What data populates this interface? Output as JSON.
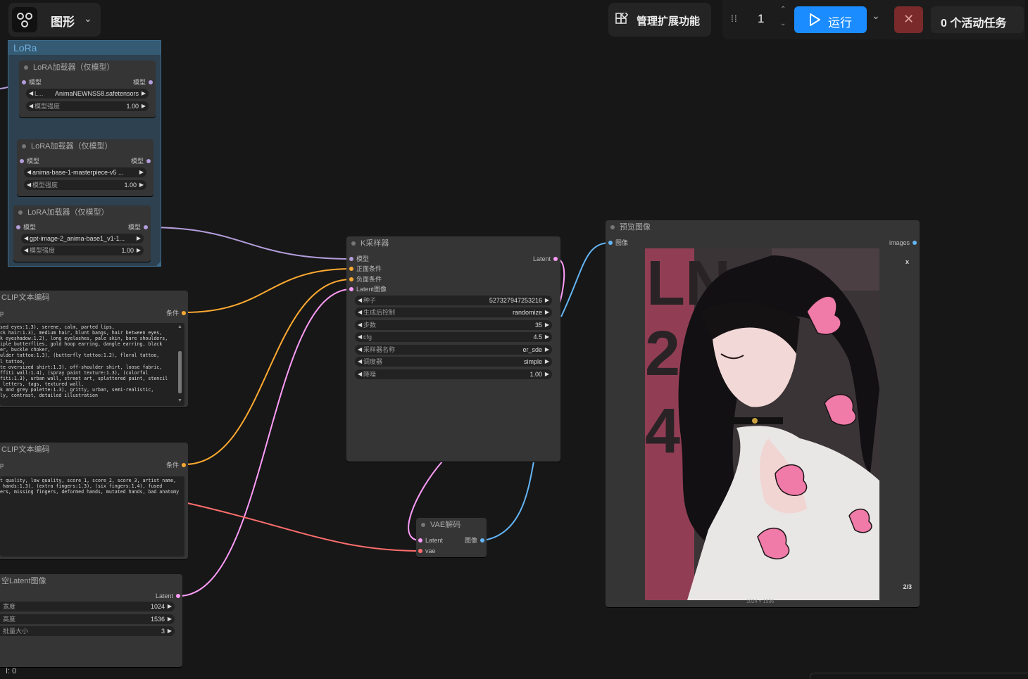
{
  "topbar": {
    "workflow_label": "图形",
    "manage_label": "管理扩展功能",
    "queue_count": "1",
    "run_label": "运行",
    "active_tasks": "0 个活动任务"
  },
  "group": {
    "title": "LoRa"
  },
  "lora1": {
    "title": "LoRA加载器（仅模型）",
    "in": "模型",
    "out": "模型",
    "name_prefix": "L...",
    "name": "AnimaNEWNSS8.safetensors",
    "strength_label": "模型强度",
    "strength": "1.00"
  },
  "lora2": {
    "title": "LoRA加载器（仅模型）",
    "in": "模型",
    "out": "模型",
    "name": "anima-base-1-masterpiece-v5 ...",
    "strength_label": "模型强度",
    "strength": "1.00"
  },
  "lora3": {
    "title": "LoRA加载器（仅模型）",
    "in": "模型",
    "out": "模型",
    "name": "gpt-image-2_anima-base1_v1-1...",
    "strength_label": "模型强度",
    "strength": "1.00"
  },
  "clip1": {
    "title": "CLIP文本编码",
    "in": "p",
    "out": "条件",
    "text": "sed eyes:1.3), serene, calm, parted lips,\nck hair:1.3), medium hair, blunt bangs, hair between eyes,\nk eyeshadow:1.2), long eyelashes, pale skin, bare shoulders,\niple butterflies, gold hoop earring, dangle earring, black\ner, buckle choker,\nulder tattoo:1.3), (butterfly tattoo:1.2), floral tattoo,\nl tattoo,\nte oversized shirt:1.3), off-shoulder shirt, loose fabric,\nffiti wall:1.4), (spray paint texture:1.3), (colorful\nfiti:1.3), urban wall, street art, splattered paint, stencil\n letters, tags, textured wall,\nk and grey palette:1.3), gritty, urban, semi-realistic,\nly, contrast, detailed illustration"
  },
  "clip2": {
    "title": "CLIP文本编码",
    "in": "p",
    "out": "条件",
    "text": "t quality, low quality, score_1, score_2, score_3, artist name,\n hands:1.3), (extra fingers:1.3), (six fingers:1.4), fused\ners, missing fingers, deformed hands, mutated hands, bad anatomy"
  },
  "latent": {
    "title": "空Latent图像",
    "out": "Latent",
    "width_label": "宽度",
    "width": "1024",
    "height_label": "高度",
    "height": "1536",
    "batch_label": "批量大小",
    "batch": "3"
  },
  "ksampler": {
    "title": "K采样器",
    "inputs": [
      "模型",
      "正面条件",
      "负面条件",
      "Latent图像"
    ],
    "out": "Latent",
    "widgets": [
      {
        "label": "种子",
        "value": "527327947253216"
      },
      {
        "label": "生成后控制",
        "value": "randomize"
      },
      {
        "label": "步数",
        "value": "35"
      },
      {
        "label": "cfg",
        "value": "4.5"
      },
      {
        "label": "采样器名称",
        "value": "er_sde"
      },
      {
        "label": "调度器",
        "value": "simple"
      },
      {
        "label": "降噪",
        "value": "1.00"
      }
    ]
  },
  "vae": {
    "title": "VAE解码",
    "in1": "Latent",
    "in2": "vae",
    "out": "图像"
  },
  "preview": {
    "title": "预览图像",
    "in": "图像",
    "out": "images",
    "close": "x",
    "counter": "2/3",
    "size": "1024 × 1536"
  },
  "status": {
    "text": "I: 0"
  },
  "colors": {
    "model": "#b39ddb",
    "cond": "#ffa931",
    "latent": "#ff9cf9",
    "image": "#64b5f6",
    "vae": "#ff6e6e",
    "run": "#1a8cff",
    "stop": "#7a2a2a"
  }
}
